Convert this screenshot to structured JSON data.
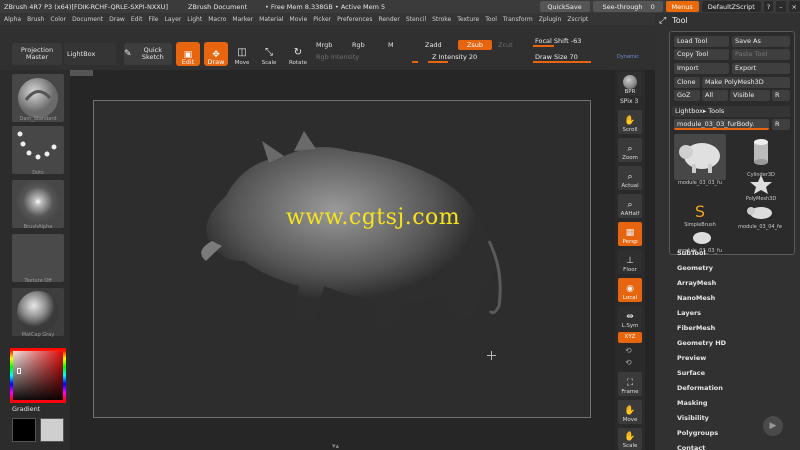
{
  "titlebar": {
    "title": "ZBrush 4R7 P3 (x64)[FDIK-RCHF-QRLE-SXPI-NXXU]",
    "doc": "ZBrush Document",
    "mem": "• Free Mem 8.338GB • Active Mem 5",
    "quicksave": "QuickSave",
    "seethrough": "See-through",
    "seethrough_val": "0",
    "menus": "Menus",
    "script": "DefaultZScript"
  },
  "menubar": [
    "Alpha",
    "Brush",
    "Color",
    "Document",
    "Draw",
    "Edit",
    "File",
    "Layer",
    "Light",
    "Macro",
    "Marker",
    "Material",
    "Movie",
    "Picker",
    "Preferences",
    "Render",
    "Stencil",
    "Stroke",
    "Texture",
    "Tool",
    "Transform",
    "Zplugin",
    "Zscript"
  ],
  "shelf": {
    "projection_master": "Projection Master",
    "lightbox": "LightBox",
    "quick_sketch": "Quick Sketch",
    "edit": "Edit",
    "draw": "Draw",
    "move": "Move",
    "scale": "Scale",
    "rotate": "Rotate",
    "mrgb": "Mrgb",
    "rgb": "Rgb",
    "m": "M",
    "zadd": "Zadd",
    "zsub": "Zsub",
    "zcut": "Zcut",
    "rgb_intensity": "Rgb Intensity",
    "z_intensity_label": "Z Intensity",
    "z_intensity": "20",
    "focal_shift_label": "Focal Shift",
    "focal_shift": "-63",
    "draw_size_label": "Draw Size",
    "draw_size": "70",
    "dynamic": "Dynamic",
    "z_intensity_pct": 0.2,
    "focal_shift_pct": 0.2,
    "draw_size_pct": 0.55
  },
  "left": {
    "brush_label": "Dam_Standard",
    "stroke_label": "Dots",
    "alpha_label": "BrushAlpha",
    "texture_label": "Texture Off",
    "material_label": "MatCap Gray",
    "gradient_label": "Gradient"
  },
  "canvas": {
    "watermark": "www.cgtsj.com"
  },
  "right_tools": {
    "bpr": "BPR",
    "spix_label": "SPix",
    "spix": "3",
    "scroll": "Scroll",
    "zoom": "Zoom",
    "actual": "Actual",
    "aahalf": "AAHalf",
    "persp": "Persp",
    "floor": "Floor",
    "local": "Local",
    "lsym": "L.Sym",
    "xyz": "XYZ",
    "frame": "Frame",
    "move": "Move",
    "scale": "Scale"
  },
  "tool": {
    "title": "Tool",
    "load_tool": "Load Tool",
    "save_as": "Save As",
    "copy_tool": "Copy Tool",
    "paste_tool": "Paste Tool",
    "import": "Import",
    "export": "Export",
    "clone": "Clone",
    "make_polymesh": "Make PolyMesh3D",
    "goz": "GoZ",
    "all": "All",
    "visible": "Visible",
    "r": "R",
    "lightbox_tools": "Lightbox▸ Tools",
    "current": "module_03_03_furBody.",
    "items": [
      "module_03_03_fu",
      "Cylinder3D",
      "PolyMesh3D",
      "SimpleBrush",
      "module_03_04_fe",
      "module_03_03_fu"
    ],
    "menu": [
      "SubTool",
      "Geometry",
      "ArrayMesh",
      "NanoMesh",
      "Layers",
      "FiberMesh",
      "Geometry HD",
      "Preview",
      "Surface",
      "Deformation",
      "Masking",
      "Visibility",
      "Polygroups",
      "Contact"
    ]
  },
  "colors": {
    "accent": "#e8650f",
    "watermark": "#f7e31a"
  }
}
